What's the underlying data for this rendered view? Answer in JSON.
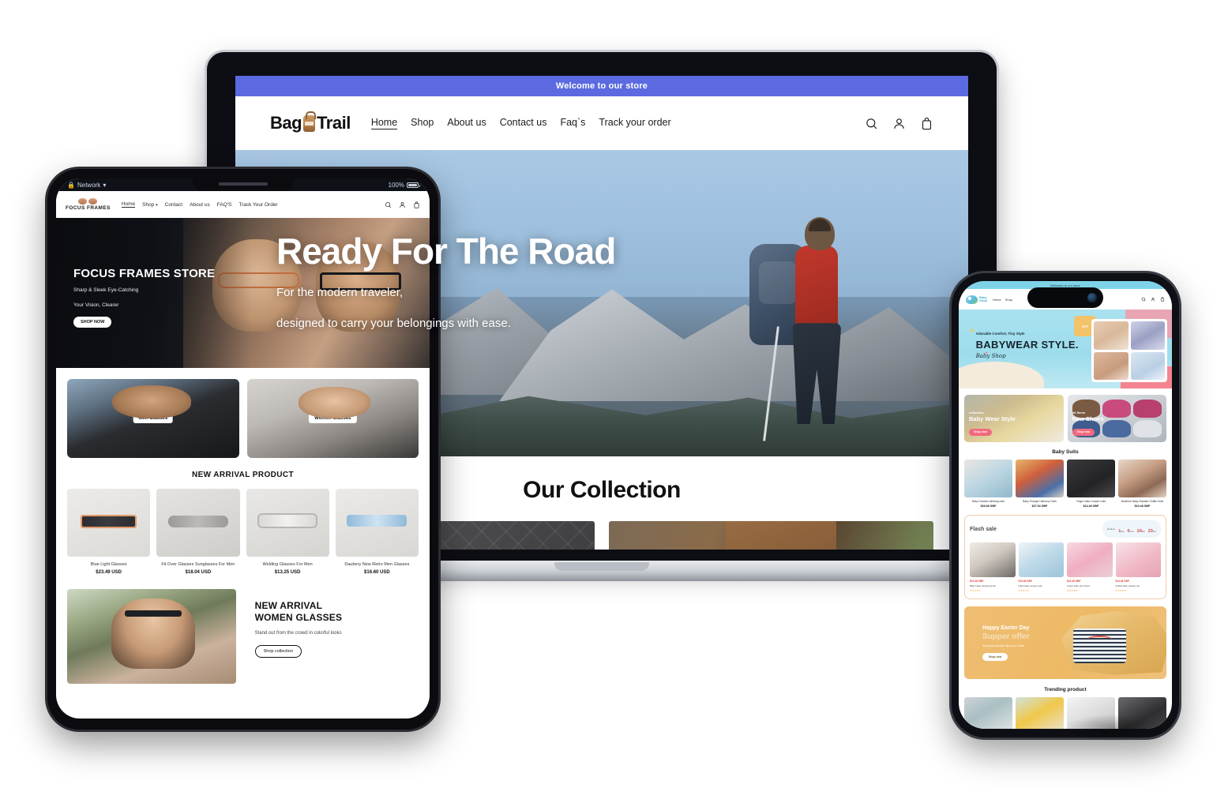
{
  "desktop": {
    "announcement": "Welcome to our store",
    "logo": {
      "part1": "Bag",
      "part2": "Trail",
      "icon": "backpack-icon"
    },
    "nav": [
      {
        "label": "Home",
        "active": true
      },
      {
        "label": "Shop",
        "active": false
      },
      {
        "label": "About us",
        "active": false
      },
      {
        "label": "Contact us",
        "active": false
      },
      {
        "label": "Faq`s",
        "active": false
      },
      {
        "label": "Track your order",
        "active": false
      }
    ],
    "icons": [
      "search-icon",
      "account-icon",
      "cart-icon"
    ],
    "hero": {
      "heading": "Ready For The Road",
      "line1": "For the modern traveler,",
      "line2": "designed to carry your belongings with ease."
    },
    "collection": {
      "title": "Our Collection",
      "cards": [
        {
          "name": "wallets-and-accessories"
        },
        {
          "name": "leather-backpacks"
        }
      ]
    }
  },
  "tablet": {
    "status": {
      "network": "Network",
      "wifi": "wifi-icon",
      "battery": "100%"
    },
    "logo": {
      "text": "FOCUS FRAMES",
      "icon": "glasses-icon"
    },
    "nav": [
      {
        "label": "Home",
        "active": true
      },
      {
        "label": "Shop",
        "active": false,
        "caret": true
      },
      {
        "label": "Contact",
        "active": false
      },
      {
        "label": "About us",
        "active": false
      },
      {
        "label": "FAQ'S",
        "active": false
      },
      {
        "label": "Track Your Order",
        "active": false
      }
    ],
    "icons": [
      "search-icon",
      "account-icon",
      "cart-icon"
    ],
    "hero": {
      "heading": "FOCUS FRAMES STORE",
      "line1": "Sharp & Sleek Eye-Catching",
      "line2": "Your Vision, Clearer",
      "button": "SHOP NOW"
    },
    "categories": [
      {
        "label": "Men Glasses"
      },
      {
        "label": "Women Glasses"
      }
    ],
    "section_title": "NEW ARRIVAL PRODUCT",
    "products": [
      {
        "name": "Blue Light Glasses",
        "price": "$23.49 USD"
      },
      {
        "name": "Fit Over Glasses Sunglasses For Men",
        "price": "$18.04 USD"
      },
      {
        "name": "Welding Glasses For Men",
        "price": "$13.25 USD"
      },
      {
        "name": "Daubery New Retro Men Glasses",
        "price": "$16.60 USD"
      }
    ],
    "banner": {
      "line1": "NEW ARRIVAL",
      "line2": "WOMEN GLASSES",
      "text": "Stand out from the crowd in colorful looks",
      "button": "Shop collection"
    }
  },
  "phone": {
    "announcement": "Welcome to our store",
    "logo": {
      "line1": "Baby",
      "line2": "Shop",
      "icon": "baby-cloud-icon"
    },
    "nav": [
      {
        "label": "Home",
        "active": true
      },
      {
        "label": "Shop",
        "active": false
      }
    ],
    "icons": [
      "search-icon",
      "account-icon",
      "cart-icon"
    ],
    "hero": {
      "sub": "Adorable Comfort, Tiny Style",
      "heading": "BABYWEAR STYLE.",
      "script": "Baby Shop",
      "badge": "OFF"
    },
    "collections": [
      {
        "kicker": "collection",
        "title": "Baby Wear Style",
        "button": "Shop now"
      },
      {
        "kicker": "All Items",
        "title": "New Shoes",
        "button": "Shop now"
      }
    ],
    "suits_title": "Baby Suits",
    "suits": [
      {
        "name": "Baby Onesies climbing suits",
        "price": "$33.68 GBP"
      },
      {
        "name": "Baby Triangle Harmony Suits",
        "price": "$27.04 GBP"
      },
      {
        "name": "Finger lotion romper suits",
        "price": "$14.28 GBP"
      },
      {
        "name": "Newborn Baby Sweater Outfits Suits",
        "price": "$19.48 GBP"
      }
    ],
    "flash": {
      "title": "Flash sale",
      "ends_label": "Ends in",
      "timer": [
        {
          "num": "1",
          "unit": "Day"
        },
        {
          "num": "0",
          "unit": "Hour"
        },
        {
          "num": "24",
          "unit": "Min"
        },
        {
          "num": "23",
          "unit": "Sec"
        }
      ],
      "items": [
        {
          "price": "$15.48 GBP",
          "name": "Baby bottle cleaning brush",
          "stars": "★★★★★"
        },
        {
          "price": "$15.48 GBP",
          "name": "Infant baby romper suits",
          "stars": "★★★★★"
        },
        {
          "price": "$15.48 GBP",
          "name": "Cotton baby print dress",
          "stars": "★★★★★"
        },
        {
          "price": "$15.48 GBP",
          "name": "Knitted baby sweater set",
          "stars": "★★★★★"
        }
      ]
    },
    "easter": {
      "line1": "Happy Easter Day",
      "line2": "Supper offer",
      "text": "Shop now and save big on our trends",
      "button": "Shop now"
    },
    "trending_title": "Trending product"
  }
}
